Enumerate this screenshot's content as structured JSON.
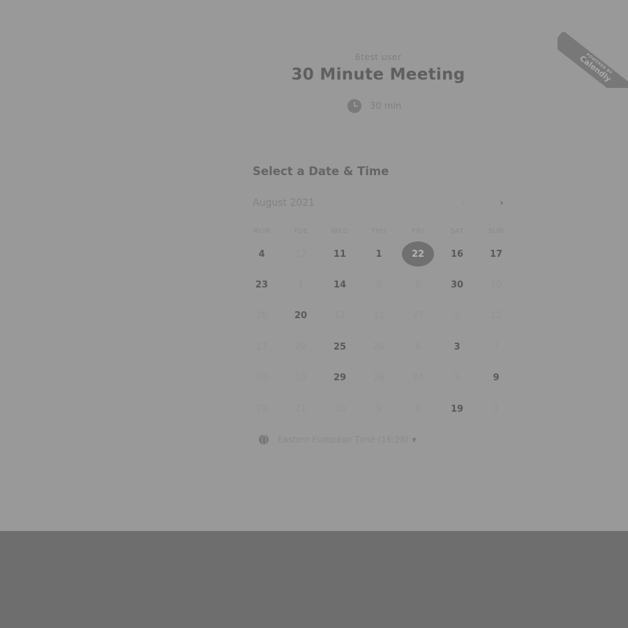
{
  "badge": {
    "powered_by": "POWERED BY",
    "brand": "Calendly"
  },
  "event": {
    "owner": "6test user",
    "title": "30 Minute Meeting",
    "duration": "30 min",
    "duration_icon": "clock-icon"
  },
  "calendar": {
    "heading": "Select a Date & Time",
    "month": "August 2021",
    "prev_icon": "chevron-left-icon",
    "next_icon": "chevron-right-icon",
    "prev_glyph": "‹",
    "next_glyph": "›",
    "weekdays": [
      "MON",
      "TUE",
      "WED",
      "THU",
      "FRI",
      "SAT",
      "SUN"
    ],
    "weeks": [
      [
        {
          "d": "4",
          "a": true
        },
        {
          "d": "12",
          "a": false
        },
        {
          "d": "11",
          "a": true
        },
        {
          "d": "1",
          "a": true
        },
        {
          "d": "22",
          "a": true,
          "s": true
        },
        {
          "d": "16",
          "a": true
        },
        {
          "d": "17",
          "a": true
        }
      ],
      [
        {
          "d": "23",
          "a": true
        },
        {
          "d": "1",
          "a": false
        },
        {
          "d": "14",
          "a": true
        },
        {
          "d": "6",
          "a": false
        },
        {
          "d": "8",
          "a": false
        },
        {
          "d": "30",
          "a": true
        },
        {
          "d": "10",
          "a": false
        }
      ],
      [
        {
          "d": "28",
          "a": false
        },
        {
          "d": "20",
          "a": true
        },
        {
          "d": "12",
          "a": false
        },
        {
          "d": "11",
          "a": false
        },
        {
          "d": "27",
          "a": false
        },
        {
          "d": "2",
          "a": false
        },
        {
          "d": "12",
          "a": false
        }
      ],
      [
        {
          "d": "17",
          "a": false
        },
        {
          "d": "28",
          "a": false
        },
        {
          "d": "25",
          "a": true
        },
        {
          "d": "26",
          "a": false
        },
        {
          "d": "6",
          "a": false
        },
        {
          "d": "3",
          "a": true
        },
        {
          "d": "7",
          "a": false
        }
      ],
      [
        {
          "d": "30",
          "a": false
        },
        {
          "d": "10",
          "a": false
        },
        {
          "d": "29",
          "a": true
        },
        {
          "d": "26",
          "a": false
        },
        {
          "d": "24",
          "a": false
        },
        {
          "d": "5",
          "a": false
        },
        {
          "d": "9",
          "a": true
        }
      ],
      [
        {
          "d": "29",
          "a": false
        },
        {
          "d": "21",
          "a": false
        },
        {
          "d": "30",
          "a": false
        },
        {
          "d": "1",
          "a": false
        },
        {
          "d": "6",
          "a": false
        },
        {
          "d": "19",
          "a": true
        },
        {
          "d": "1",
          "a": false
        }
      ]
    ]
  },
  "timezone": {
    "label": "Eastern European Time (16:28)",
    "icon": "globe-icon",
    "caret": "▼"
  },
  "colors": {
    "background": "#999999",
    "overlay_band": "#6e6e6e",
    "selected_day": "#707070"
  }
}
